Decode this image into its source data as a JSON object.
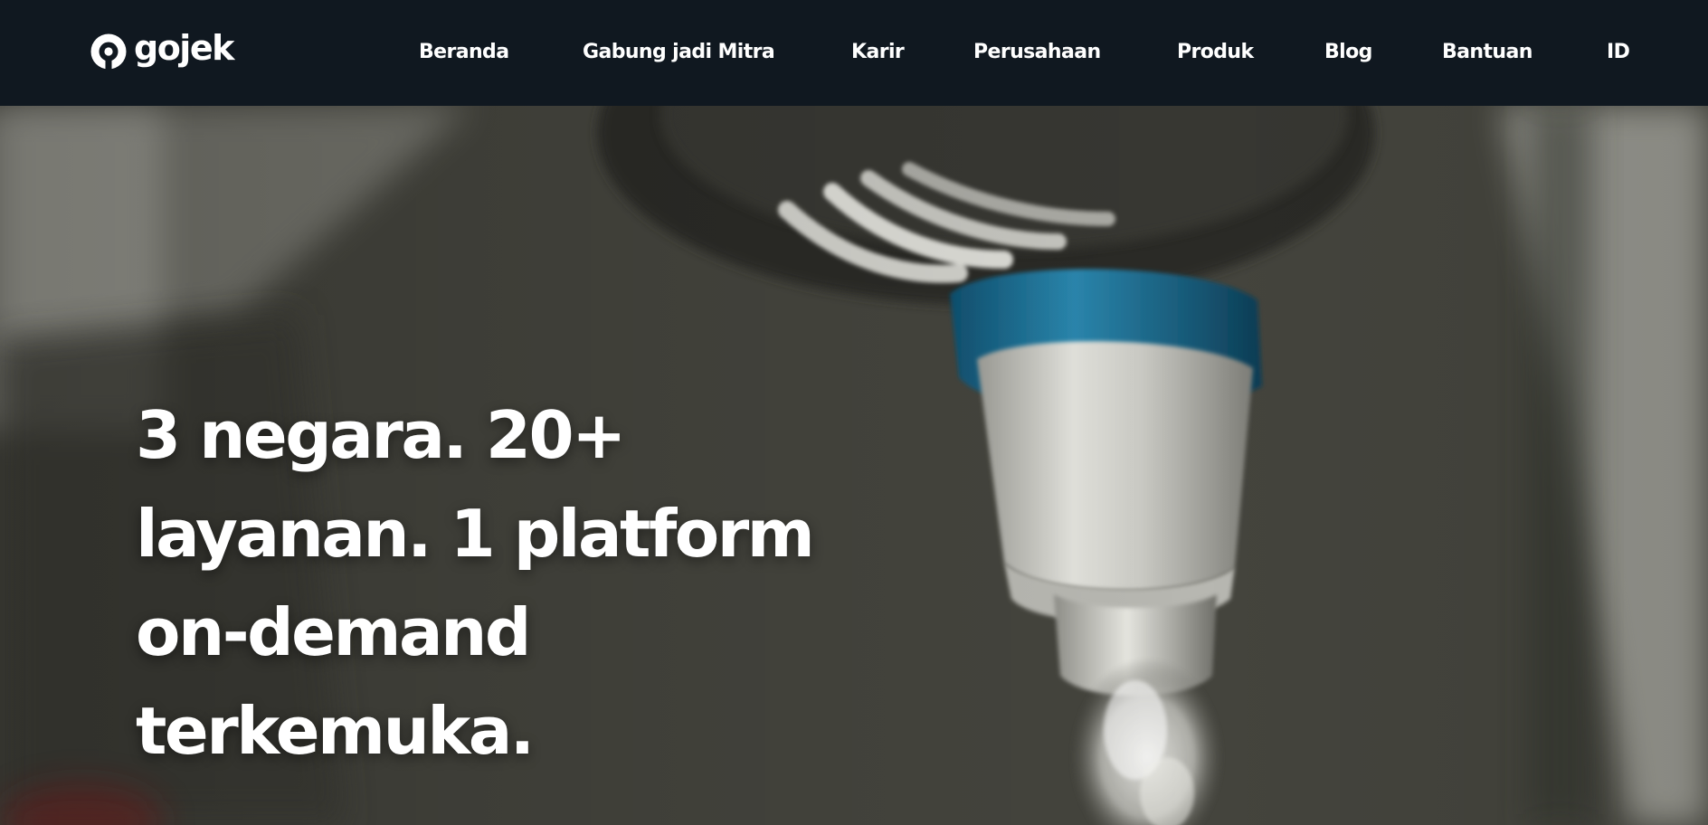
{
  "brand": {
    "name": "gojek",
    "logo_icon": "gojek-logo-icon"
  },
  "nav": {
    "items": [
      {
        "label": "Beranda"
      },
      {
        "label": "Gabung jadi Mitra"
      },
      {
        "label": "Karir"
      },
      {
        "label": "Perusahaan"
      },
      {
        "label": "Produk"
      },
      {
        "label": "Blog"
      },
      {
        "label": "Bantuan"
      },
      {
        "label": "ID"
      }
    ]
  },
  "hero": {
    "headline_lines": [
      "3 negara. 20+",
      "layanan. 1 platform",
      "on-demand",
      "terkemuka."
    ],
    "background_subject": "water-faucet-photo"
  },
  "colors": {
    "navbar_bg": "#101820",
    "text": "#ffffff",
    "faucet_accent": "#1c6f93"
  }
}
